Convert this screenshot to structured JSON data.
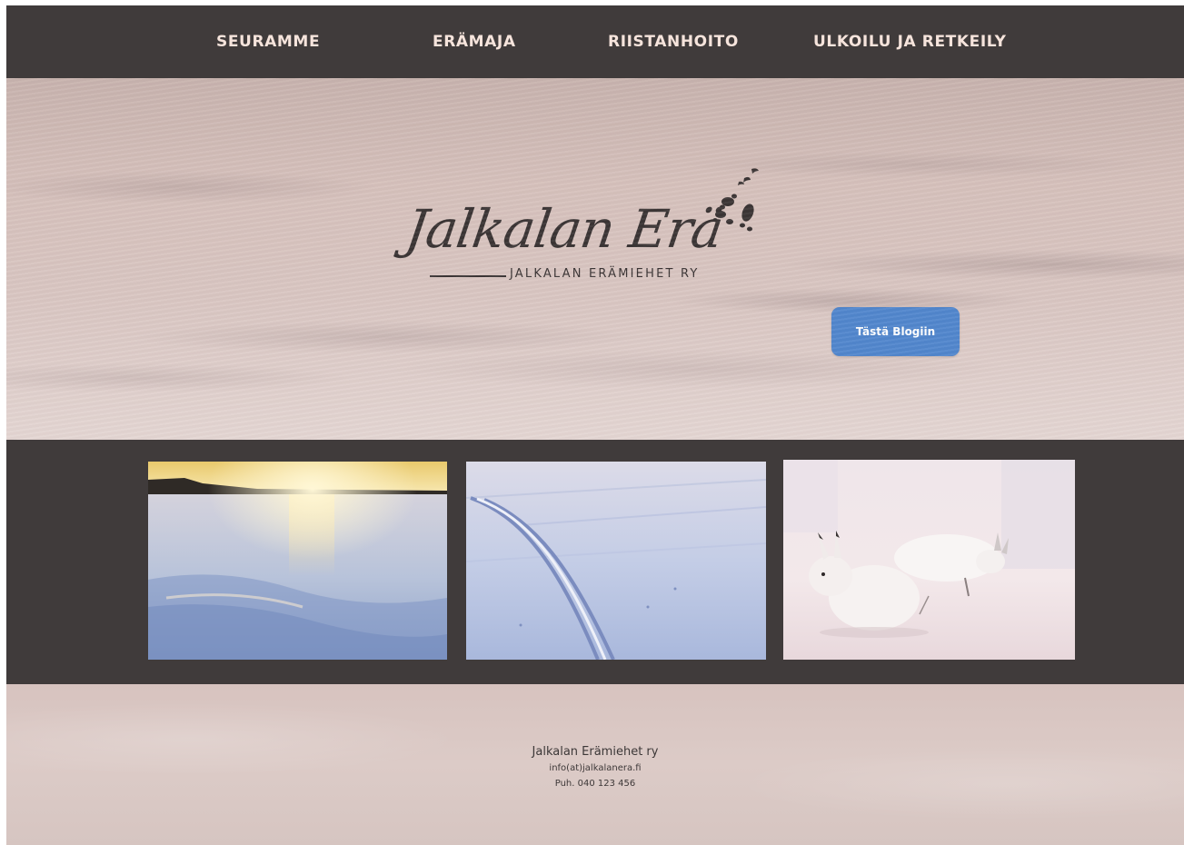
{
  "nav": {
    "items": [
      {
        "label": "SEURAMME"
      },
      {
        "label": "ERÄMAJA"
      },
      {
        "label": "RIISTANHOITO"
      },
      {
        "label": "ULKOILU JA RETKEILY"
      }
    ]
  },
  "hero": {
    "logo_text": "Jalkalan Erä",
    "logo_subtitle": "JALKALAN ERÄMIEHET RY",
    "blog_button_label": "Tästä Blogiin"
  },
  "gallery": {
    "photos": [
      {
        "subject": "sunset-over-snowfield"
      },
      {
        "subject": "ski-tracks-in-snow"
      },
      {
        "subject": "snow-hares"
      }
    ]
  },
  "footer": {
    "organization": "Jalkalan Erämiehet ry",
    "email": "info(at)jalkalanera.fi",
    "phone": "Puh. 040 123 456"
  },
  "colors": {
    "nav_background": "#403b3b",
    "nav_text": "#f6e4dc",
    "button": "#5287cd",
    "logo": "#3b3535"
  }
}
